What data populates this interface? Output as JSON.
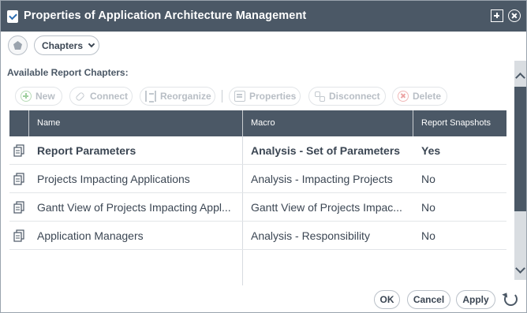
{
  "dialog": {
    "title": "Properties of Application Architecture Management"
  },
  "topbar": {
    "chapters_label": "Chapters"
  },
  "section": {
    "label": "Available Report Chapters:"
  },
  "toolbar": {
    "new_label": "New",
    "connect_label": "Connect",
    "reorganize_label": "Reorganize",
    "properties_label": "Properties",
    "disconnect_label": "Disconnect",
    "delete_label": "Delete"
  },
  "grid": {
    "columns": [
      "Name",
      "Macro",
      "Report Snapshots"
    ],
    "rows": [
      {
        "name": "Report Parameters",
        "macro": "Analysis - Set of Parameters",
        "snapshots": "Yes"
      },
      {
        "name": "Projects Impacting Applications",
        "macro": "Analysis - Impacting Projects",
        "snapshots": "No"
      },
      {
        "name": "Gantt View of Projects Impacting Appl...",
        "macro": "Gantt View of Projects Impac...",
        "snapshots": "No"
      },
      {
        "name": "Application Managers",
        "macro": "Analysis - Responsibility",
        "snapshots": "No"
      }
    ]
  },
  "footer": {
    "ok_label": "OK",
    "cancel_label": "Cancel",
    "apply_label": "Apply"
  },
  "icons": {
    "title": "document-check-icon",
    "row": "report-chapter-icon"
  },
  "colors": {
    "header_bg": "#4b5866",
    "disabled_text": "#b8bec5",
    "text": "#3b4653"
  }
}
